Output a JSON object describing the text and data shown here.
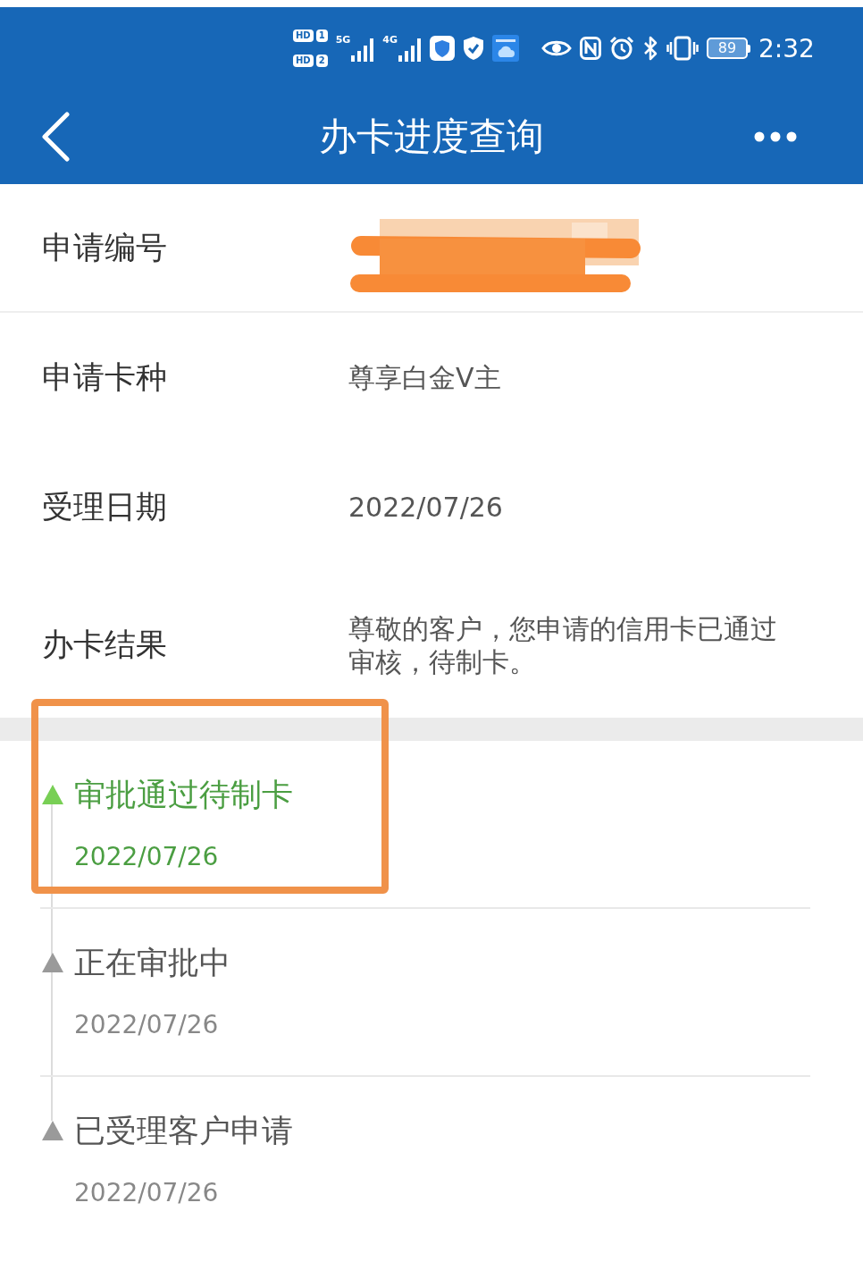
{
  "status_bar": {
    "sim_slots": [
      {
        "badge": "HD",
        "slot": "1"
      },
      {
        "badge": "HD",
        "slot": "2"
      }
    ],
    "signals": [
      {
        "network": "5G"
      },
      {
        "network": "4G"
      }
    ],
    "battery": "89",
    "time": "2:32"
  },
  "nav": {
    "title": "办卡进度查询"
  },
  "details": [
    {
      "label": "申请编号",
      "redacted": true
    },
    {
      "label": "申请卡种",
      "value": "尊享白金V主",
      "redacted": false
    },
    {
      "label": "受理日期",
      "value": "2022/07/26",
      "redacted": false
    },
    {
      "label": "办卡结果",
      "value": "尊敬的客户，您申请的信用卡已通过审核，待制卡。",
      "redacted": false
    }
  ],
  "timeline": [
    {
      "title": "审批通过待制卡",
      "date": "2022/07/26",
      "active": true,
      "highlighted": true
    },
    {
      "title": "正在审批中",
      "date": "2022/07/26",
      "active": false,
      "highlighted": false
    },
    {
      "title": "已受理客户申请",
      "date": "2022/07/26",
      "active": false,
      "highlighted": false
    }
  ]
}
